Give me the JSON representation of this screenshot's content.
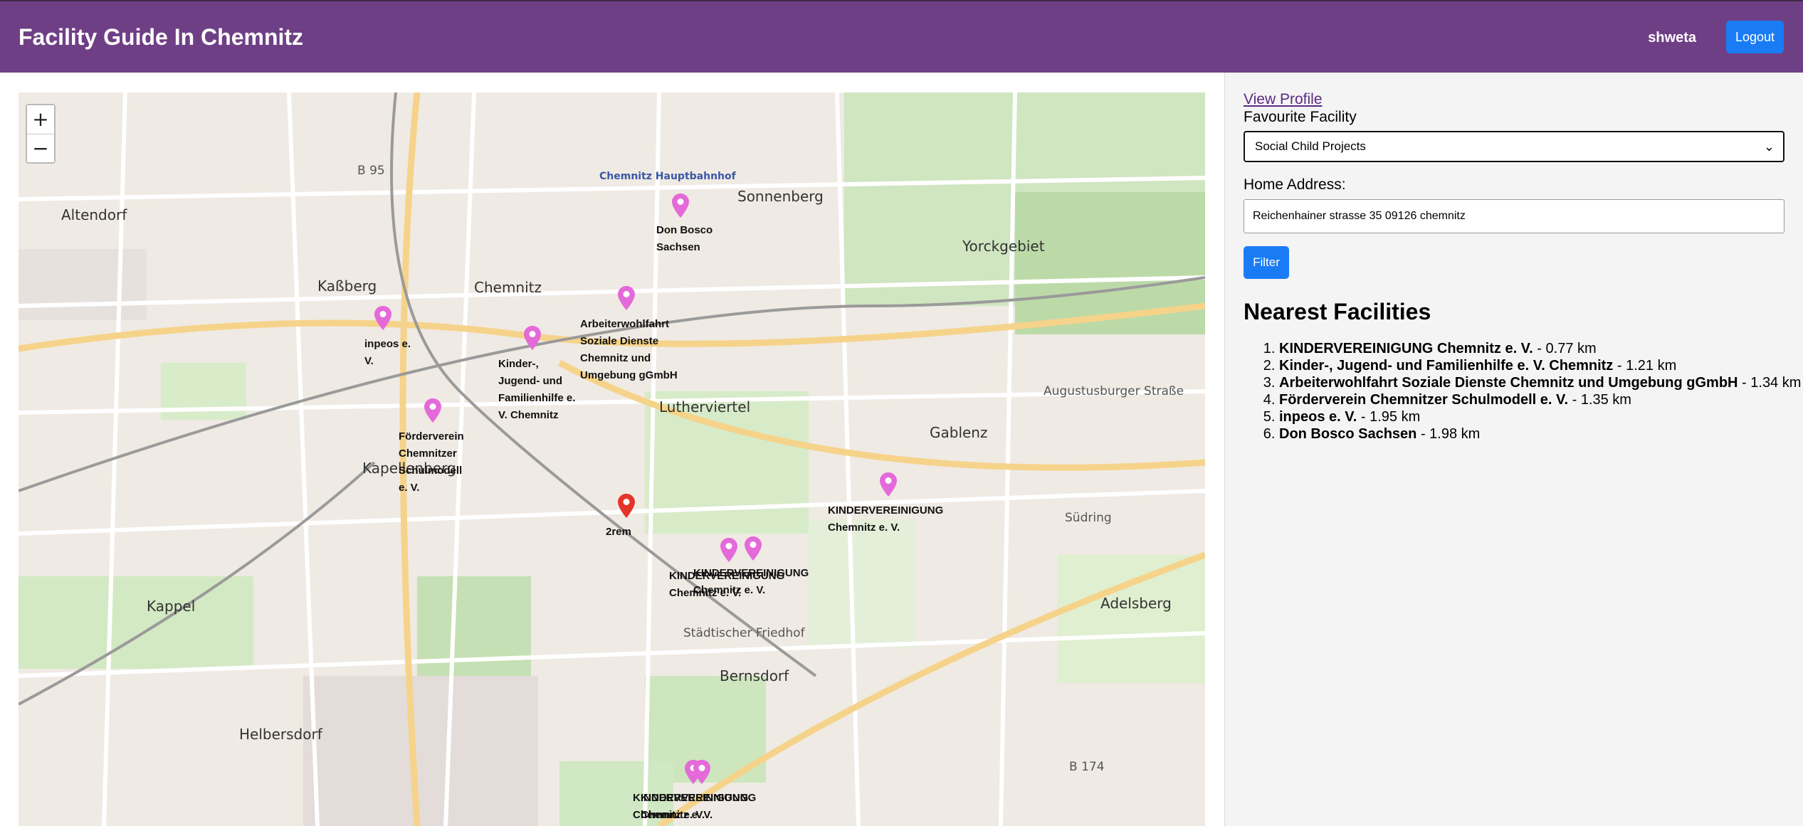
{
  "header": {
    "title": "Facility Guide In Chemnitz",
    "username": "shweta",
    "logout_label": "Logout",
    "background": "#6f3f86"
  },
  "map": {
    "zoom_in": "+",
    "zoom_out": "−",
    "place_labels": [
      "Altendorf",
      "Kaßberg",
      "Chemnitz",
      "Sonnenberg",
      "Yorckgebiet",
      "Lutherviertel",
      "Gablenz",
      "Kapellenberg",
      "Kappel",
      "Bernsdorf",
      "Helbersdorf",
      "Adelsberg",
      "Chemnitz Hauptbahnhof",
      "Städtischer Friedhof",
      "B 95",
      "B 174",
      "Südring",
      "Augustusburger Straße"
    ],
    "markers": [
      {
        "label": "Don Bosco Sachsen",
        "color": "#e36ad8"
      },
      {
        "label": "Arbeiterwohlfahrt Soziale Dienste Chemnitz und Umgebung gGmbH",
        "color": "#e36ad8"
      },
      {
        "label": "inpeos e. V.",
        "color": "#e36ad8"
      },
      {
        "label": "Kinder-, Jugend- und Familienhilfe e. V. Chemnitz",
        "color": "#e36ad8"
      },
      {
        "label": "Förderverein Chemnitzer Schulmodell e. V.",
        "color": "#e36ad8"
      },
      {
        "label": "KINDERVEREINIGUNG Chemnitz e. V.",
        "color": "#e36ad8"
      },
      {
        "label": "2rem",
        "color": "#e5352b"
      },
      {
        "label": "KINDERVEREINIGUNG Chemnitz e. V.",
        "color": "#e36ad8"
      },
      {
        "label": "KINDERVEREINIGUNG Chemnitz e. V.",
        "color": "#e36ad8"
      },
      {
        "label": "KINDERVEREINIGUNG Chemnitz e. V.",
        "color": "#e36ad8"
      },
      {
        "label": "KINDERVEREINIGUNG Chemnitz e. V.",
        "color": "#e36ad8"
      }
    ]
  },
  "sidebar": {
    "view_profile": "View Profile",
    "favourite_label": "Favourite Facility",
    "favourite_value": "Social Child Projects",
    "home_label": "Home Address:",
    "home_value": "Reichenhainer strasse 35 09126 chemnitz",
    "filter_label": "Filter",
    "nearest_title": "Nearest Facilities",
    "nearest": [
      {
        "name": "KINDERVEREINIGUNG Chemnitz e. V.",
        "distance": " - 0.77 km"
      },
      {
        "name": "Kinder-, Jugend- und Familienhilfe e. V. Chemnitz",
        "distance": " - 1.21 km"
      },
      {
        "name": "Arbeiterwohlfahrt Soziale Dienste Chemnitz und Umgebung gGmbH",
        "distance": " - 1.34 km"
      },
      {
        "name": "Förderverein Chemnitzer Schulmodell e. V.",
        "distance": " - 1.35 km"
      },
      {
        "name": "inpeos e. V.",
        "distance": " - 1.95 km"
      },
      {
        "name": "Don Bosco Sachsen",
        "distance": " - 1.98 km"
      }
    ]
  }
}
